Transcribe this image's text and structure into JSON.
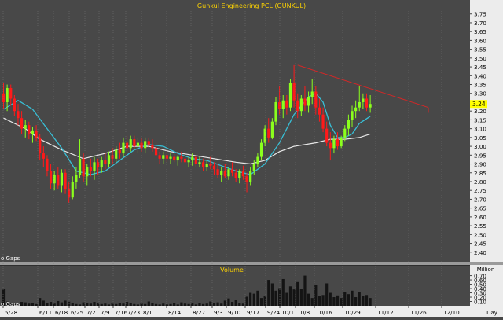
{
  "colors": {
    "background": "#484848",
    "axis_bg": "#ececec",
    "grid": "#7a7a7a",
    "title": "#ffd400",
    "up": "#8bff1d",
    "down": "#ff1a1a",
    "ma_short": "#38bfd6",
    "ma_long": "#e8e8e8",
    "trendline": "#d02828",
    "volume": "#141414",
    "price_tag": "#ffff00"
  },
  "chart_data": [
    {
      "type": "candlestick",
      "title": "Gunkul Engineering PCL (GUNKUL)",
      "gaps_label": "o Gaps",
      "last_price_tag": "3.24",
      "ylim": [
        2.35,
        3.78
      ],
      "yticks": [
        "2.40",
        "2.45",
        "2.50",
        "2.55",
        "2.60",
        "2.65",
        "2.70",
        "2.75",
        "2.80",
        "2.85",
        "2.90",
        "2.95",
        "3.00",
        "3.05",
        "3.10",
        "3.15",
        "3.20",
        "3.25",
        "3.30",
        "3.35",
        "3.40",
        "3.45",
        "3.50",
        "3.55",
        "3.60",
        "3.65",
        "3.70",
        "3.75"
      ],
      "x_tick_labels": [
        "5/28",
        "6/11",
        "6/18",
        "6/25",
        "7/2",
        "7/9",
        "7/16",
        "7/23",
        "8/1",
        "8/14",
        "8/27",
        "9/3",
        "9/10",
        "9/17",
        "9/24",
        "10/1",
        "10/8",
        "10/16",
        "10/29",
        "11/12",
        "11/26",
        "12/10"
      ],
      "x_axis_unit": "Day",
      "candles": [
        [
          3.3,
          3.36,
          3.21,
          3.25
        ],
        [
          3.25,
          3.35,
          3.2,
          3.33
        ],
        [
          3.33,
          3.35,
          3.23,
          3.27
        ],
        [
          3.27,
          3.29,
          3.17,
          3.2
        ],
        [
          3.2,
          3.24,
          3.12,
          3.16
        ],
        [
          3.16,
          3.2,
          3.07,
          3.1
        ],
        [
          3.1,
          3.15,
          3.05,
          3.12
        ],
        [
          3.12,
          3.14,
          3.04,
          3.07
        ],
        [
          3.07,
          3.11,
          3.02,
          3.09
        ],
        [
          3.09,
          3.12,
          3.03,
          3.05
        ],
        [
          3.05,
          3.07,
          2.92,
          2.96
        ],
        [
          2.96,
          3.0,
          2.88,
          2.93
        ],
        [
          2.93,
          2.95,
          2.83,
          2.86
        ],
        [
          2.86,
          2.9,
          2.76,
          2.79
        ],
        [
          2.79,
          2.86,
          2.75,
          2.84
        ],
        [
          2.84,
          2.88,
          2.76,
          2.78
        ],
        [
          2.78,
          2.87,
          2.74,
          2.85
        ],
        [
          2.85,
          2.87,
          2.73,
          2.76
        ],
        [
          2.76,
          2.8,
          2.68,
          2.71
        ],
        [
          2.71,
          2.83,
          2.7,
          2.8
        ],
        [
          2.8,
          2.88,
          2.76,
          2.84
        ],
        [
          2.84,
          3.04,
          2.82,
          2.93
        ],
        [
          2.93,
          2.96,
          2.8,
          2.83
        ],
        [
          2.83,
          2.9,
          2.78,
          2.88
        ],
        [
          2.88,
          2.93,
          2.83,
          2.86
        ],
        [
          2.86,
          2.94,
          2.81,
          2.91
        ],
        [
          2.91,
          2.93,
          2.84,
          2.88
        ],
        [
          2.88,
          2.94,
          2.85,
          2.92
        ],
        [
          2.92,
          2.96,
          2.87,
          2.9
        ],
        [
          2.9,
          2.97,
          2.88,
          2.95
        ],
        [
          2.95,
          2.99,
          2.9,
          2.93
        ],
        [
          2.93,
          3.0,
          2.91,
          2.98
        ],
        [
          2.98,
          3.02,
          2.93,
          2.96
        ],
        [
          2.96,
          3.05,
          2.94,
          3.02
        ],
        [
          3.02,
          3.06,
          2.96,
          2.99
        ],
        [
          2.99,
          3.06,
          2.97,
          3.04
        ],
        [
          3.04,
          3.06,
          2.98,
          3.0
        ],
        [
          3.0,
          3.05,
          2.96,
          3.02
        ],
        [
          3.02,
          3.05,
          2.97,
          2.99
        ],
        [
          2.99,
          3.05,
          2.96,
          3.03
        ],
        [
          3.03,
          3.05,
          2.99,
          3.01
        ],
        [
          3.01,
          3.04,
          2.97,
          2.99
        ],
        [
          2.99,
          3.02,
          2.94,
          2.95
        ],
        [
          2.95,
          2.97,
          2.9,
          2.93
        ],
        [
          2.93,
          2.97,
          2.9,
          2.95
        ],
        [
          2.95,
          2.97,
          2.91,
          2.93
        ],
        [
          2.93,
          2.96,
          2.9,
          2.94
        ],
        [
          2.94,
          2.96,
          2.91,
          2.92
        ],
        [
          2.92,
          2.95,
          2.89,
          2.94
        ],
        [
          2.94,
          2.97,
          2.91,
          2.93
        ],
        [
          2.93,
          2.96,
          2.89,
          2.91
        ],
        [
          2.91,
          2.94,
          2.88,
          2.92
        ],
        [
          2.92,
          2.96,
          2.89,
          2.94
        ],
        [
          2.94,
          2.95,
          2.88,
          2.9
        ],
        [
          2.9,
          2.94,
          2.88,
          2.91
        ],
        [
          2.91,
          2.93,
          2.86,
          2.88
        ],
        [
          2.88,
          2.92,
          2.86,
          2.9
        ],
        [
          2.9,
          2.94,
          2.87,
          2.89
        ],
        [
          2.89,
          2.91,
          2.84,
          2.87
        ],
        [
          2.87,
          2.9,
          2.82,
          2.84
        ],
        [
          2.84,
          2.88,
          2.8,
          2.86
        ],
        [
          2.86,
          2.9,
          2.82,
          2.83
        ],
        [
          2.83,
          2.88,
          2.81,
          2.87
        ],
        [
          2.87,
          2.91,
          2.83,
          2.85
        ],
        [
          2.85,
          2.87,
          2.8,
          2.82
        ],
        [
          2.82,
          2.87,
          2.79,
          2.86
        ],
        [
          2.86,
          2.89,
          2.81,
          2.83
        ],
        [
          2.83,
          2.85,
          2.74,
          2.8
        ],
        [
          2.8,
          2.88,
          2.78,
          2.86
        ],
        [
          2.86,
          2.92,
          2.84,
          2.9
        ],
        [
          2.9,
          2.96,
          2.88,
          2.94
        ],
        [
          2.94,
          3.04,
          2.92,
          3.02
        ],
        [
          3.02,
          3.12,
          3.0,
          3.1
        ],
        [
          3.1,
          3.16,
          3.02,
          3.05
        ],
        [
          3.05,
          3.16,
          3.04,
          3.14
        ],
        [
          3.14,
          3.28,
          3.12,
          3.25
        ],
        [
          3.25,
          3.34,
          3.18,
          3.21
        ],
        [
          3.21,
          3.29,
          3.16,
          3.26
        ],
        [
          3.26,
          3.29,
          3.18,
          3.22
        ],
        [
          3.22,
          3.38,
          3.2,
          3.36
        ],
        [
          3.36,
          3.46,
          3.22,
          3.26
        ],
        [
          3.26,
          3.3,
          3.16,
          3.2
        ],
        [
          3.2,
          3.29,
          3.17,
          3.27
        ],
        [
          3.27,
          3.34,
          3.2,
          3.23
        ],
        [
          3.23,
          3.31,
          3.19,
          3.28
        ],
        [
          3.28,
          3.38,
          3.24,
          3.31
        ],
        [
          3.31,
          3.34,
          3.18,
          3.22
        ],
        [
          3.22,
          3.27,
          3.14,
          3.18
        ],
        [
          3.18,
          3.22,
          3.08,
          3.1
        ],
        [
          3.1,
          3.14,
          3.0,
          3.02
        ],
        [
          3.02,
          3.08,
          2.92,
          2.99
        ],
        [
          2.99,
          3.06,
          2.96,
          3.04
        ],
        [
          3.04,
          3.08,
          2.98,
          3.0
        ],
        [
          3.0,
          3.06,
          2.99,
          3.05
        ],
        [
          3.05,
          3.12,
          3.03,
          3.1
        ],
        [
          3.1,
          3.18,
          3.06,
          3.15
        ],
        [
          3.15,
          3.23,
          3.11,
          3.2
        ],
        [
          3.2,
          3.26,
          3.16,
          3.22
        ],
        [
          3.22,
          3.34,
          3.2,
          3.25
        ],
        [
          3.25,
          3.3,
          3.21,
          3.27
        ],
        [
          3.27,
          3.3,
          3.2,
          3.22
        ],
        [
          3.22,
          3.29,
          3.19,
          3.24
        ]
      ],
      "ma_short": [
        [
          0,
          3.21
        ],
        [
          4,
          3.26
        ],
        [
          8,
          3.21
        ],
        [
          12,
          3.1
        ],
        [
          16,
          2.99
        ],
        [
          20,
          2.86
        ],
        [
          24,
          2.84
        ],
        [
          28,
          2.86
        ],
        [
          32,
          2.92
        ],
        [
          36,
          2.98
        ],
        [
          40,
          3.01
        ],
        [
          44,
          3.0
        ],
        [
          48,
          2.96
        ],
        [
          52,
          2.93
        ],
        [
          56,
          2.92
        ],
        [
          60,
          2.89
        ],
        [
          64,
          2.86
        ],
        [
          68,
          2.84
        ],
        [
          72,
          2.9
        ],
        [
          76,
          3.02
        ],
        [
          80,
          3.18
        ],
        [
          84,
          3.28
        ],
        [
          86,
          3.3
        ],
        [
          88,
          3.25
        ],
        [
          90,
          3.12
        ],
        [
          92,
          3.05
        ],
        [
          94,
          3.05
        ],
        [
          96,
          3.07
        ],
        [
          98,
          3.13
        ],
        [
          101,
          3.17
        ]
      ],
      "ma_long": [
        [
          0,
          3.16
        ],
        [
          6,
          3.1
        ],
        [
          10,
          3.04
        ],
        [
          16,
          2.98
        ],
        [
          22,
          2.93
        ],
        [
          28,
          2.96
        ],
        [
          34,
          3.0
        ],
        [
          40,
          3.0
        ],
        [
          46,
          2.97
        ],
        [
          52,
          2.95
        ],
        [
          58,
          2.93
        ],
        [
          64,
          2.91
        ],
        [
          68,
          2.9
        ],
        [
          72,
          2.92
        ],
        [
          76,
          2.97
        ],
        [
          80,
          3.0
        ],
        [
          86,
          3.02
        ],
        [
          90,
          3.04
        ],
        [
          94,
          3.04
        ],
        [
          98,
          3.05
        ],
        [
          101,
          3.07
        ]
      ],
      "trendline": [
        [
          81,
          3.46
        ],
        [
          117,
          3.22
        ]
      ],
      "trendline_end_tick": [
        117,
        3.19
      ],
      "price_labels": [
        "3.24"
      ]
    },
    {
      "type": "bar",
      "title": "Volume",
      "unit": "Million",
      "gaps_label": "o Gaps",
      "ylim": [
        0,
        0.82
      ],
      "yticks": [
        "0.10",
        "0.20",
        "0.30",
        "0.40",
        "0.50",
        "0.60",
        "0.70"
      ],
      "values": [
        0.4,
        0.1,
        0.06,
        0.04,
        0.03,
        0.09,
        0.08,
        0.05,
        0.07,
        0.04,
        0.18,
        0.12,
        0.07,
        0.09,
        0.05,
        0.11,
        0.08,
        0.12,
        0.1,
        0.06,
        0.04,
        0.03,
        0.08,
        0.06,
        0.05,
        0.09,
        0.07,
        0.04,
        0.05,
        0.03,
        0.06,
        0.04,
        0.07,
        0.05,
        0.09,
        0.06,
        0.04,
        0.03,
        0.05,
        0.04,
        0.1,
        0.07,
        0.04,
        0.03,
        0.05,
        0.03,
        0.04,
        0.06,
        0.03,
        0.08,
        0.05,
        0.04,
        0.06,
        0.03,
        0.07,
        0.04,
        0.05,
        0.1,
        0.06,
        0.08,
        0.05,
        0.12,
        0.17,
        0.09,
        0.14,
        0.06,
        0.05,
        0.21,
        0.3,
        0.28,
        0.35,
        0.18,
        0.22,
        0.6,
        0.52,
        0.35,
        0.41,
        0.62,
        0.3,
        0.45,
        0.38,
        0.55,
        0.4,
        0.7,
        0.28,
        0.18,
        0.48,
        0.22,
        0.25,
        0.52,
        0.3,
        0.2,
        0.24,
        0.18,
        0.31,
        0.27,
        0.35,
        0.2,
        0.32,
        0.22,
        0.25,
        0.18
      ]
    }
  ]
}
